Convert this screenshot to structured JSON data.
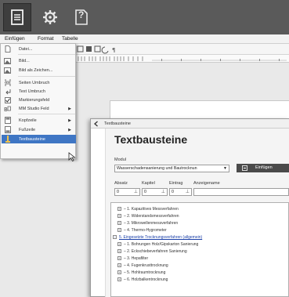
{
  "toolbar_top": {
    "icons": [
      "document-icon",
      "gear-icon",
      "help-icon"
    ],
    "help_glyph": "?"
  },
  "menubar": {
    "items": [
      "Einfügen",
      "Format",
      "Tabelle"
    ]
  },
  "insert_menu": {
    "items": [
      {
        "label": "Datei...",
        "icon": "file-icon"
      },
      {
        "label": "Bild...",
        "icon": "image-icon"
      },
      {
        "label": "Bild als Zeichen...",
        "icon": "image-char-icon"
      },
      {
        "label": "Seiten Umbruch",
        "icon": "page-break-icon"
      },
      {
        "label": "Text Umbruch",
        "icon": "text-break-icon"
      },
      {
        "label": "Markierungsfeld",
        "icon": "checkbox-icon"
      },
      {
        "label": "MM Studio Feld",
        "icon": "field-icon",
        "submenu": true
      },
      {
        "label": "Kopfzeile",
        "icon": "header-icon",
        "submenu": true
      },
      {
        "label": "Fußzeile",
        "icon": "footer-icon",
        "submenu": true
      },
      {
        "label": "Textbausteine",
        "icon": "textblock-icon",
        "selected": true
      }
    ]
  },
  "dialog": {
    "window_title": "Textbausteine",
    "heading": "Textbausteine",
    "modul_label": "Modul",
    "modul_value": "Wasserschadensanierung und Bautrocknun",
    "insert_button": "Einfügen",
    "absatz_label": "Absatz",
    "kapitel_label": "Kapitel",
    "eintrag_label": "Eintrag",
    "anzeigename_label": "Anzeigename",
    "absatz_value": "0",
    "kapitel_value": "0",
    "eintrag_value": "0",
    "anzeigename_value": "",
    "tree": [
      {
        "text": "– 1. Kapazitives Messverfahren",
        "level": 1,
        "collapsed": true
      },
      {
        "text": "– 2. Widerstandsmessverfahren",
        "level": 1,
        "collapsed": true
      },
      {
        "text": "– 3. Mikrowellenmessverfahren",
        "level": 1,
        "collapsed": true
      },
      {
        "text": "– 4. Thermo-Hygrometer",
        "level": 1,
        "collapsed": true
      },
      {
        "text": "5. Eingesetzte Trocknungsverfahren (allgemein)",
        "level": 0,
        "expanded": true,
        "link": true
      },
      {
        "text": "– 1. Bohrungen Holz/Gipskarton Sanierung",
        "level": 1,
        "collapsed": true
      },
      {
        "text": "– 2. Eckschiebeverfahren Sanierung",
        "level": 1,
        "collapsed": true
      },
      {
        "text": "– 3. Hepafilter",
        "level": 1,
        "collapsed": true
      },
      {
        "text": "– 4. Fugenkrusttrocknung",
        "level": 1,
        "collapsed": true
      },
      {
        "text": "– 5. Hohlraumtrocknung",
        "level": 1,
        "collapsed": true
      },
      {
        "text": "– 6. Holzbalkentrocknung",
        "level": 1,
        "collapsed": true
      }
    ]
  }
}
